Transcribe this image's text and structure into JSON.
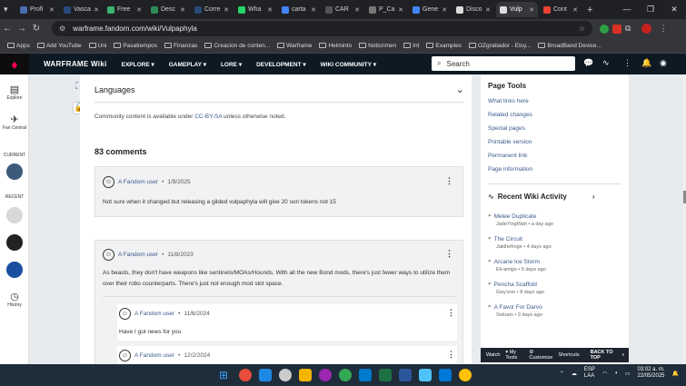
{
  "browser": {
    "tabs": [
      {
        "label": "Profi",
        "color": "#4a6fb5"
      },
      {
        "label": "Vasca",
        "color": "#2a4a7a"
      },
      {
        "label": "Free",
        "color": "#3cb371"
      },
      {
        "label": "Desc",
        "color": "#2e8b57"
      },
      {
        "label": "Corre",
        "color": "#2a4a7a"
      },
      {
        "label": "Wha",
        "color": "#25d366"
      },
      {
        "label": "carta",
        "color": "#4285f4"
      },
      {
        "label": "CAR",
        "color": "#555"
      },
      {
        "label": "P_Ca",
        "color": "#777"
      },
      {
        "label": "Gene",
        "color": "#4285f4"
      },
      {
        "label": "Disco",
        "color": "#ddd"
      },
      {
        "label": "Vulp",
        "color": "#ddd"
      },
      {
        "label": "Cont",
        "color": "#ea4335"
      }
    ],
    "url": "warframe.fandom.com/wiki/Vulpaphyla",
    "bookmarks": [
      "Apps",
      "Add YouTube",
      "Uni",
      "Pasatiempos",
      "Finanzas",
      "Creacion de conten...",
      "Warframe",
      "Helminto",
      "Noticrimen",
      "Int",
      "Examples",
      "OZgrabador - Etsy...",
      "BroadBand Device..."
    ]
  },
  "wiki": {
    "title": "WARFRAME Wiki",
    "menu": [
      "EXPLORE",
      "GAMEPLAY",
      "LORE",
      "DEVELOPMENT",
      "WIKI COMMUNITY"
    ],
    "search_placeholder": "Search"
  },
  "rail": {
    "explore": "Explore",
    "fan_central": "Fan Central",
    "current": "CURRENT",
    "recent": "RECENT",
    "history": "History"
  },
  "article": {
    "languages": "Languages",
    "license_pre": "Community content is available under",
    "license_link": "CC-BY-SA",
    "license_post": "unless otherwise noted.",
    "comments_count": "83 comments",
    "comments": [
      {
        "user": "A Fandom user",
        "date": "1/9/2025",
        "text": "Not sure when it changed but releasing a gilded vulpaphyla will give 20 son tokens not 15"
      },
      {
        "user": "A Fandom user",
        "date": "11/8/2023",
        "text": "As beasts, they don't have weapons like sentinels/MOAs/Hounds. With all the new Bond mods, there's just fewer ways to utilize them over their robo counterparts. There's just not enough mod slot space."
      }
    ],
    "replies": [
      {
        "user": "A Fandom user",
        "date": "11/6/2024",
        "text": "Have I got news for you"
      },
      {
        "user": "A Fandom user",
        "date": "12/2/2024",
        "text": ""
      }
    ]
  },
  "sidebar": {
    "page_tools_title": "Page Tools",
    "page_tools": [
      "What links here",
      "Related changes",
      "Special pages",
      "Printable version",
      "Permanent link",
      "Page information"
    ],
    "recent_title": "Recent Wiki Activity",
    "recent": [
      {
        "title": "Melee Duplicate",
        "meta": "JadeYingWah • a day ago"
      },
      {
        "title": "The Circuit",
        "meta": "Jakthefroge • 4 days ago"
      },
      {
        "title": "Arcane Ice Storm",
        "meta": "Eli-amigo • 5 days ago"
      },
      {
        "title": "Pencha Scaffold",
        "meta": "Gwy'eon • 8 days ago"
      },
      {
        "title": "A Favor For Darvo",
        "meta": "Sekram • 9 days ago"
      }
    ]
  },
  "toolbar": {
    "watch": "Watch",
    "my_tools": "My Tools",
    "customize": "Customize",
    "shortcuts": "Shortcuts",
    "back_to_top": "BACK TO TOP"
  },
  "taskbar": {
    "lang": "ESP",
    "region": "LAA",
    "time": "03:02 a. m.",
    "date": "22/05/2025"
  }
}
